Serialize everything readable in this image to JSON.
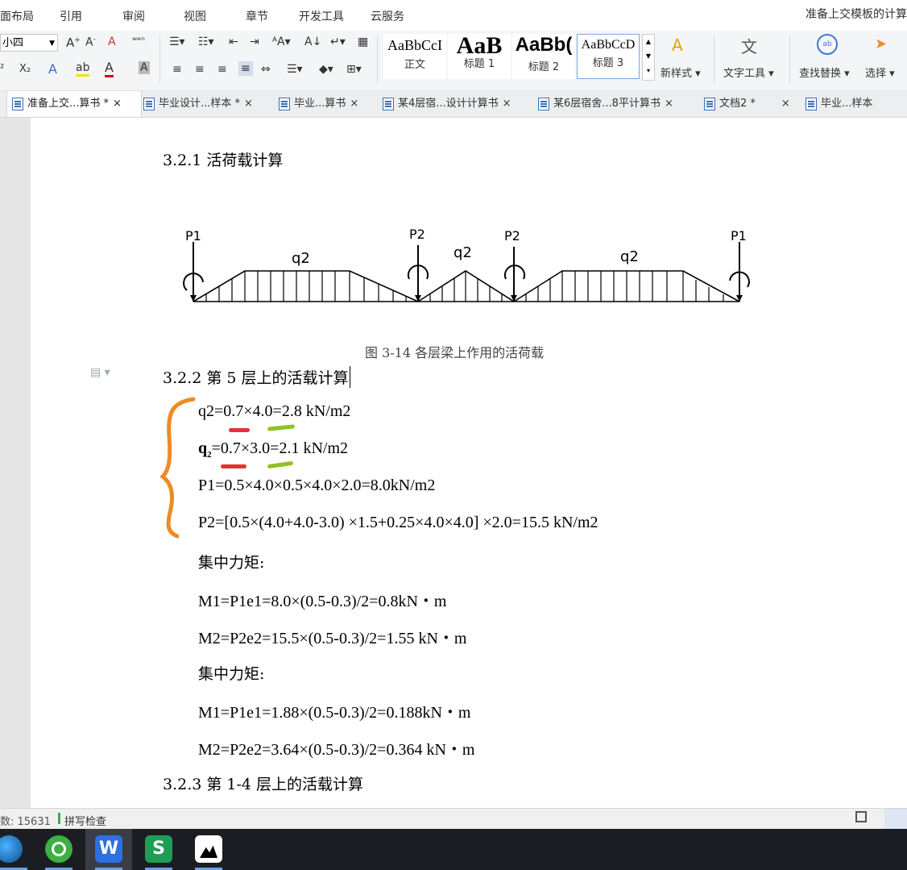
{
  "menubar": {
    "items": [
      "面布局",
      "引用",
      "审阅",
      "视图",
      "章节",
      "开发工具",
      "云服务"
    ],
    "doc_title": "准备上交模板的计算"
  },
  "ribbon": {
    "font_size": "小四",
    "styles": [
      {
        "sample": "AaBbCcI",
        "name": "正文"
      },
      {
        "sample": "AaB",
        "name": "标题 1"
      },
      {
        "sample": "AaBb(",
        "name": "标题 2"
      },
      {
        "sample": "AaBbCcD",
        "name": "标题 3"
      }
    ],
    "new_style": "新样式",
    "text_tools": "文字工具",
    "find_replace": "查找替换",
    "select": "选择"
  },
  "tabs": [
    {
      "label": "准备上交...算书 *",
      "active": true
    },
    {
      "label": "毕业设计...样本 *",
      "active": false
    },
    {
      "label": "毕业...算书",
      "active": false
    },
    {
      "label": "某4层宿...设计计算书",
      "active": false
    },
    {
      "label": "某6层宿舍...8平计算书",
      "active": false
    },
    {
      "label": "文档2 *",
      "active": false
    },
    {
      "label": "毕业...样本",
      "active": false
    }
  ],
  "document": {
    "heading_321": "3.2.1  活荷载计算",
    "diagram": {
      "labels": {
        "p1_left": "P1",
        "p2_a": "P2",
        "p2_b": "P2",
        "p1_right": "P1",
        "q2_a": "q2",
        "q2_b": "q2",
        "q2_c": "q2"
      }
    },
    "caption": "图 3-14  各层梁上作用的活荷载",
    "heading_322": "3.2.2 第 5 层上的活载计算",
    "formulas": [
      "q2=0.7×4.0=2.8 kN/m2",
      "=0.7×3.0=2.1 kN/m2",
      "P1=0.5×4.0×0.5×4.0×2.0=8.0kN/m2",
      "P2=[0.5×(4.0+4.0-3.0)  ×1.5+0.25×4.0×4.0]  ×2.0=15.5 kN/m2",
      "集中力矩:",
      "M1=P1e1=8.0×(0.5-0.3)/2=0.8kN・m",
      "M2=P2e2=15.5×(0.5-0.3)/2=1.55 kN・m",
      "集中力矩:",
      "M1=P1e1=1.88×(0.5-0.3)/2=0.188kN・m",
      "M2=P2e2=3.64×(0.5-0.3)/2=0.364 kN・m"
    ],
    "q2_prime_symbol": "q",
    "q2_prime_sub": "2",
    "heading_323": "3.2.3 第 1-4 层上的活载计算"
  },
  "statusbar": {
    "word_count": "数: 15631",
    "spell_check": "拼写检查"
  }
}
